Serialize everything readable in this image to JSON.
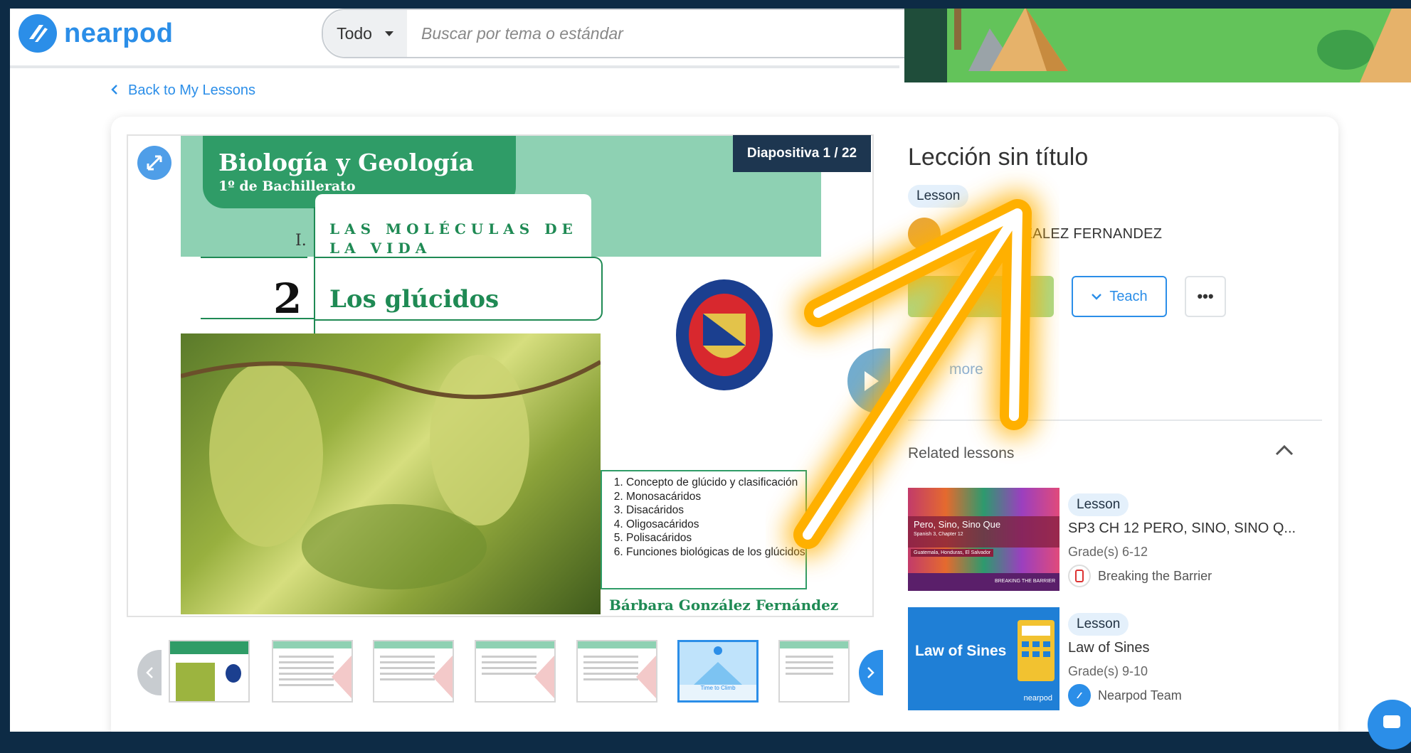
{
  "brand": {
    "logo_text": "nearpod",
    "color": "#2b8ee8"
  },
  "search": {
    "scope": "Todo",
    "placeholder": "Buscar por tema o estándar"
  },
  "nav": {
    "back_label": "Back to My Lessons"
  },
  "slide": {
    "counter": "Diapositiva 1 / 22",
    "title": "Biología y Geología",
    "subtitle": "1º de Bachillerato",
    "unit_number": "I.",
    "unit_title": "LAS MOLÉCULAS DE LA VIDA",
    "topic_number": "2",
    "topic_title": "Los glúcidos",
    "toc": [
      "Concepto de glúcido y clasificación",
      "Monosacáridos",
      "Disacáridos",
      "Oligosacáridos",
      "Polisacáridos",
      "Funciones biológicas de los glúcidos"
    ],
    "author": "Bárbara González Fernández"
  },
  "thumbnails": {
    "count": 7,
    "active_index": 5,
    "active_caption": "Time to Climb"
  },
  "lesson": {
    "title": "Lección sin título",
    "type": "Lesson",
    "author_visible": "NZALEZ FERNANDEZ",
    "teach_label": "Teach",
    "more_menu": "•••",
    "more_link": "more"
  },
  "related": {
    "heading": "Related lessons",
    "items": [
      {
        "type": "Lesson",
        "title": "SP3 CH 12 PERO, SINO, SINO Q...",
        "grades": "Grade(s) 6-12",
        "author": "Breaking the Barrier",
        "thumb_title": "Pero, Sino, Sino Que",
        "thumb_sub": "Spanish 3, Chapter 12",
        "thumb_tag": "Guatemala, Honduras, El Salvador",
        "thumb_brand": "BREAKING THE BARRIER"
      },
      {
        "type": "Lesson",
        "title": "Law of Sines",
        "grades": "Grade(s) 9-10",
        "author": "Nearpod Team",
        "thumb_title": "Law of Sines",
        "thumb_brand": "nearpod"
      }
    ]
  },
  "colors": {
    "accent": "#2b8ee8",
    "slide_green": "#2f9c67",
    "arrow_glow": "#ffb000"
  }
}
